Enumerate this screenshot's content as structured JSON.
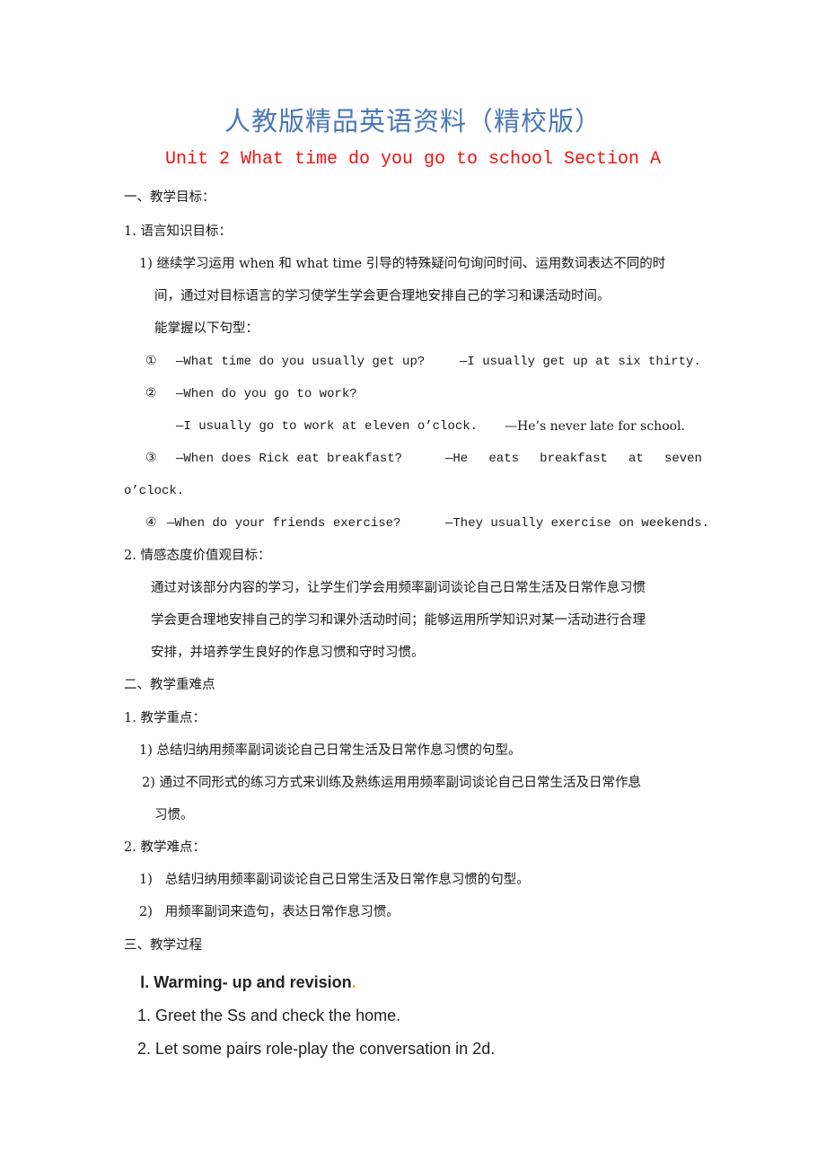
{
  "document": {
    "title": "人教版精品英语资料（精校版）",
    "subtitle": "Unit 2 What time do you go to school Section A",
    "colors": {
      "title": "#4a78b8",
      "subtitle": "#f21010"
    },
    "sections": [
      {
        "heading": "一、教学目标：",
        "items": {
          "lang_goal": {
            "heading": "1. 语言知识目标：",
            "point1_line1": "1) 继续学习运用 when 和 what time 引导的特殊疑问句询问时间、运用数词表达不同的时",
            "point1_line2": "间，通过对目标语言的学习使学生学会更合理地安排自己的学习和课活动时间。",
            "patterns_label": "能掌握以下句型：",
            "patterns": [
              {
                "num": "①",
                "q": "—What time do you usually get up?",
                "a": "—I usually get up at six thirty."
              },
              {
                "num": "②",
                "q": "—When do you go to work?",
                "a1": "—I usually go to work at eleven o’clock.",
                "a2": "—He’s never late for school."
              },
              {
                "num": "③",
                "q": "—When does Rick eat breakfast?",
                "a_words": [
                  "—He",
                  "eats",
                  "breakfast",
                  "at",
                  "seven"
                ],
                "a_cont": "o’clock."
              },
              {
                "num": "④",
                "q": "—When do your friends exercise?",
                "a": "—They usually exercise on weekends."
              }
            ]
          },
          "emotion_goal": {
            "heading": "2. 情感态度价值观目标：",
            "line1": "通过对该部分内容的学习，让学生们学会用频率副词谈论自己日常生活及日常作息习惯",
            "line2": "学会更合理地安排自己的学习和课外活动时间；能够运用所学知识对某一活动进行合理",
            "line3": "安排，并培养学生良好的作息习惯和守时习惯。"
          }
        }
      },
      {
        "heading": "二、教学重难点",
        "key_points": {
          "heading": "1. 教学重点：",
          "p1": "1) 总结归纳用频率副词谈论自己日常生活及日常作息习惯的句型。",
          "p2_line1": "2) 通过不同形式的练习方式来训练及熟练运用用频率副词谈论自己日常生活及日常作息",
          "p2_line2": "习惯。"
        },
        "difficult_points": {
          "heading": "2. 教学难点：",
          "p1": "1)   总结归纳用频率副词谈论自己日常生活及日常作息习惯的句型。",
          "p2": "2)   用频率副词来造句，表达日常作息习惯。"
        }
      },
      {
        "heading": "三、教学过程",
        "step1": {
          "heading": "Ⅰ. Warming- up and revision",
          "heading_dot": ".",
          "item1": "1. Greet the Ss and check the home.",
          "item2": "2. Let some pairs role-play the conversation in 2d."
        }
      }
    ]
  }
}
